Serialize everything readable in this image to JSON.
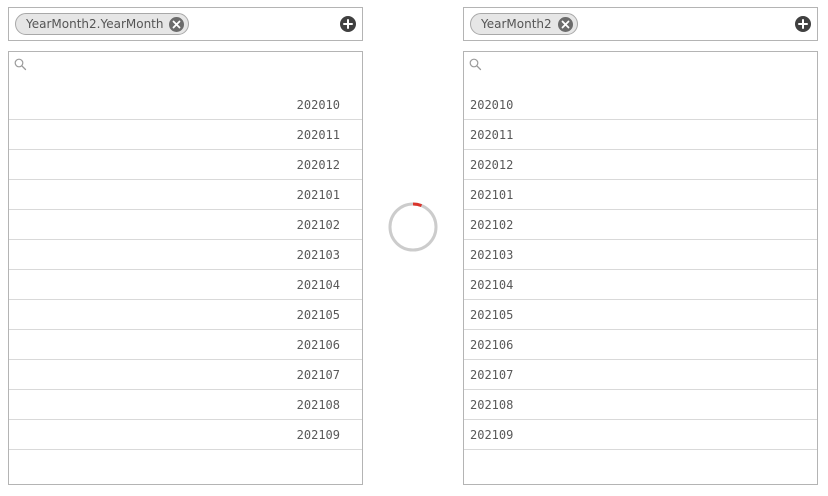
{
  "left_panel": {
    "filter_chip_label": "YearMonth2.YearMonth",
    "search_placeholder": "",
    "values": [
      "202010",
      "202011",
      "202012",
      "202101",
      "202102",
      "202103",
      "202104",
      "202105",
      "202106",
      "202107",
      "202108",
      "202109"
    ]
  },
  "right_panel": {
    "filter_chip_label": "YearMonth2",
    "search_placeholder": "",
    "values": [
      "202010",
      "202011",
      "202012",
      "202101",
      "202102",
      "202103",
      "202104",
      "202105",
      "202106",
      "202107",
      "202108",
      "202109"
    ]
  },
  "icons": {
    "chip_close": "close-circle-icon",
    "add": "plus-circle-icon",
    "search": "search-icon",
    "loading": "loading-spinner-icon"
  },
  "colors": {
    "spinner_track": "#cccccc",
    "spinner_accent": "#d9342b",
    "border": "#b4b4b4",
    "row_divider": "#d9d9d9",
    "text": "#595959"
  }
}
